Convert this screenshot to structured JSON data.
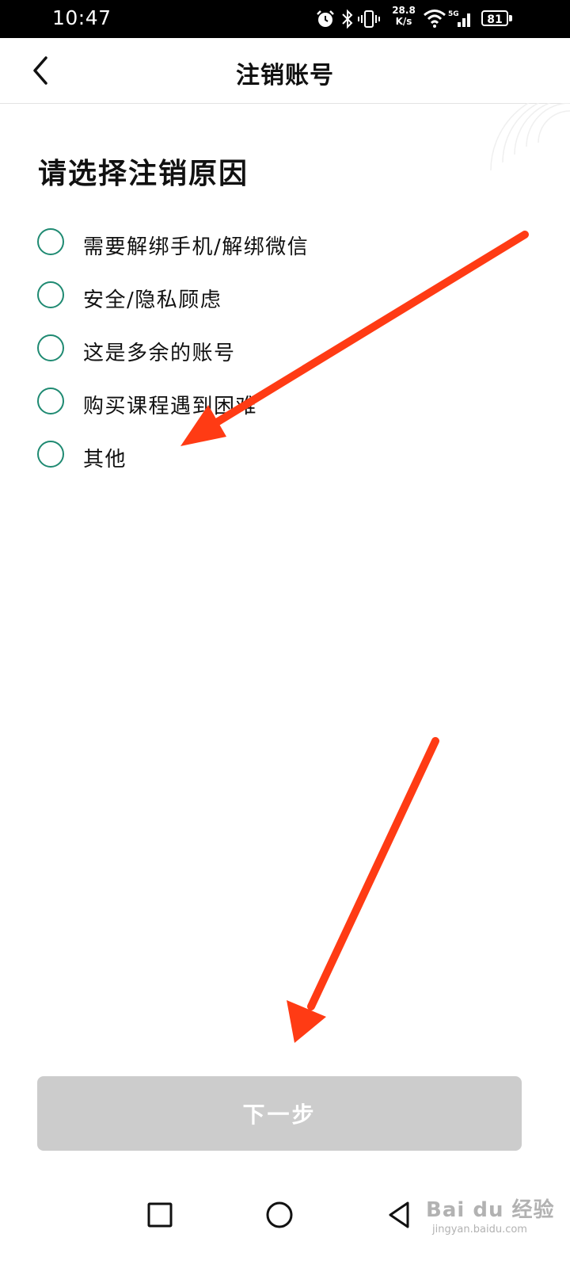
{
  "status_bar": {
    "time": "10:47",
    "net_speed_value": "28.8",
    "net_speed_unit": "K/s",
    "battery": "81",
    "icons": [
      "alarm-icon",
      "bluetooth-icon",
      "vibrate-icon",
      "wifi-icon",
      "signal-5g-icon",
      "battery-icon"
    ]
  },
  "header": {
    "title": "注销账号",
    "back_icon": "chevron-left-icon"
  },
  "main": {
    "section_title": "请选择注销原因",
    "options": [
      {
        "label": "需要解绑手机/解绑微信",
        "selected": false
      },
      {
        "label": "安全/隐私顾虑",
        "selected": false
      },
      {
        "label": "这是多余的账号",
        "selected": false
      },
      {
        "label": "购买课程遇到困难",
        "selected": false
      },
      {
        "label": "其他",
        "selected": false
      }
    ],
    "radio_color": "#1f8a72"
  },
  "annotations": {
    "arrow_color": "#ff3b14"
  },
  "next_button": {
    "label": "下一步",
    "background": "#cccccc"
  },
  "nav_bar": {
    "icons": [
      "square-icon",
      "circle-icon",
      "triangle-back-icon"
    ]
  },
  "watermark": {
    "brand": "Bai du 经验",
    "url": "jingyan.baidu.com"
  }
}
